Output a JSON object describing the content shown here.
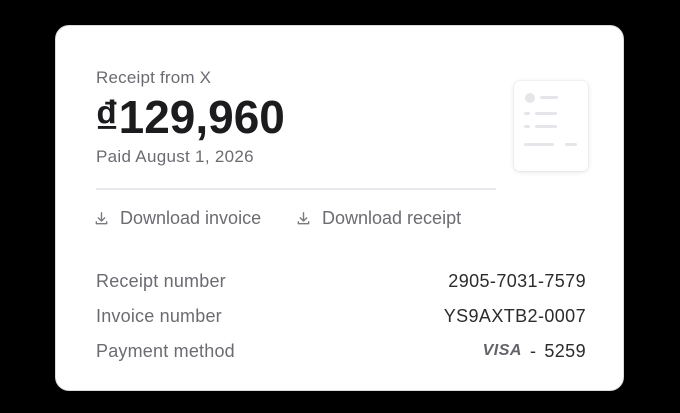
{
  "receipt": {
    "subtitle": "Receipt from X",
    "amount": "₫129,960",
    "paid_date": "Paid August 1, 2026"
  },
  "actions": {
    "download_invoice": "Download invoice",
    "download_receipt": "Download receipt"
  },
  "details": {
    "receipt_number_label": "Receipt number",
    "receipt_number_value": "2905-7031-7579",
    "invoice_number_label": "Invoice number",
    "invoice_number_value": "YS9AXTB2-0007",
    "payment_method_label": "Payment method",
    "card_brand": "VISA",
    "card_separator": "-",
    "card_last4": "5259"
  },
  "icons": {
    "download": "download-icon",
    "document": "receipt-document-icon"
  },
  "colors": {
    "background": "#000000",
    "card": "#ffffff",
    "primary_text": "#1c1c1e",
    "secondary_text": "#6b6b72"
  }
}
